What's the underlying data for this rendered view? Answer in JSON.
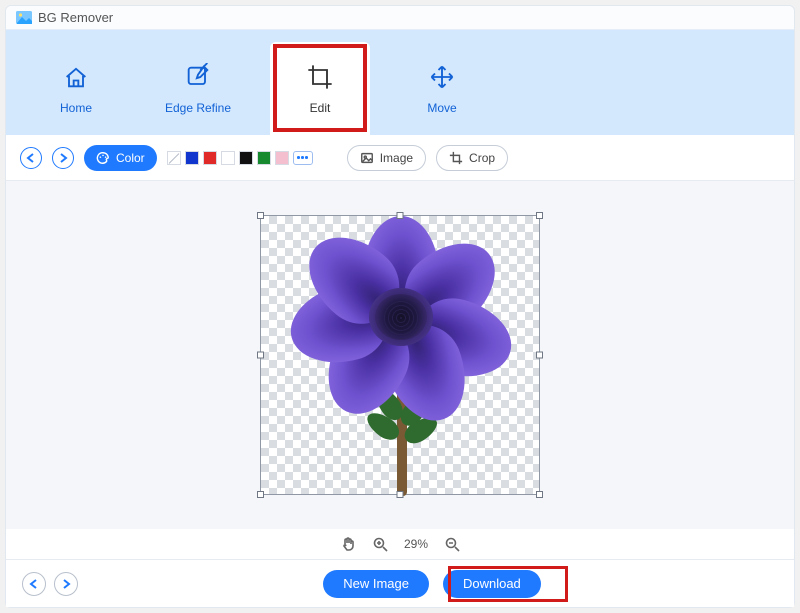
{
  "app": {
    "title": "BG Remover"
  },
  "tabs": {
    "home": {
      "label": "Home"
    },
    "refine": {
      "label": "Edge Refine"
    },
    "edit": {
      "label": "Edit"
    },
    "move": {
      "label": "Move"
    }
  },
  "toolbar": {
    "color_label": "Color",
    "image_label": "Image",
    "crop_label": "Crop",
    "swatches": [
      "none",
      "#1036ce",
      "#e02a2a",
      "#ffffff",
      "#111111",
      "#178a2f",
      "#f4bfcf"
    ]
  },
  "zoom": {
    "value": "29%"
  },
  "footer": {
    "new_image": "New Image",
    "download": "Download"
  }
}
